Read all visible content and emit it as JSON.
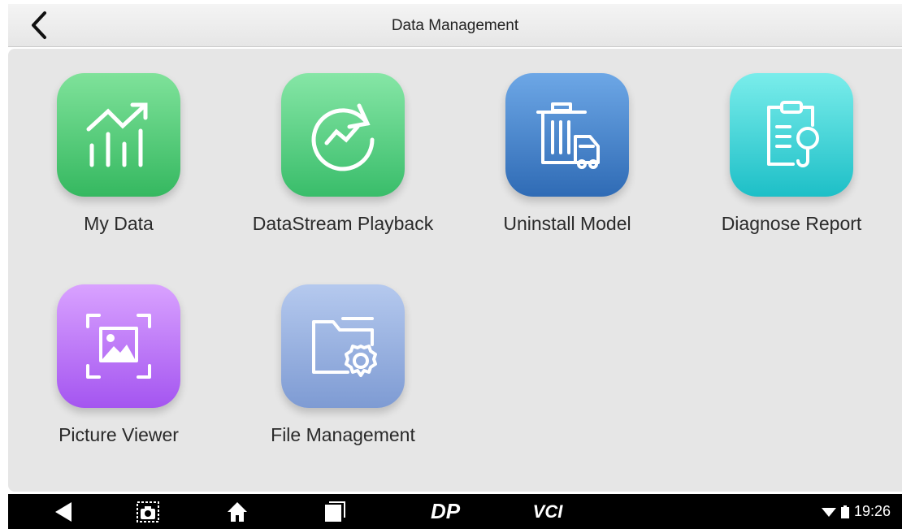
{
  "header": {
    "title": "Data Management",
    "back_icon": "chevron-left-icon"
  },
  "apps": [
    {
      "label": "My Data",
      "icon": "bar-chart-trend-icon",
      "color": "#35b860"
    },
    {
      "label": "DataStream Playback",
      "icon": "refresh-trend-icon",
      "color": "#39bd6a"
    },
    {
      "label": "Uninstall Model",
      "icon": "trash-car-icon",
      "color": "#2f6bb5"
    },
    {
      "label": "Diagnose Report",
      "icon": "clipboard-search-icon",
      "color": "#1dbfc7"
    },
    {
      "label": "Picture Viewer",
      "icon": "image-frame-icon",
      "color": "#a455f0"
    },
    {
      "label": "File Management",
      "icon": "folder-gear-icon",
      "color": "#7e9bd3"
    }
  ],
  "navbar": {
    "back_icon": "nav-back-icon",
    "screenshot_icon": "camera-icon",
    "home_icon": "home-icon",
    "recents_icon": "recents-icon",
    "dp_logo": "DP",
    "vci_logo": "VCI",
    "time": "19:26",
    "wifi_icon": "wifi-icon",
    "battery_icon": "battery-icon"
  }
}
